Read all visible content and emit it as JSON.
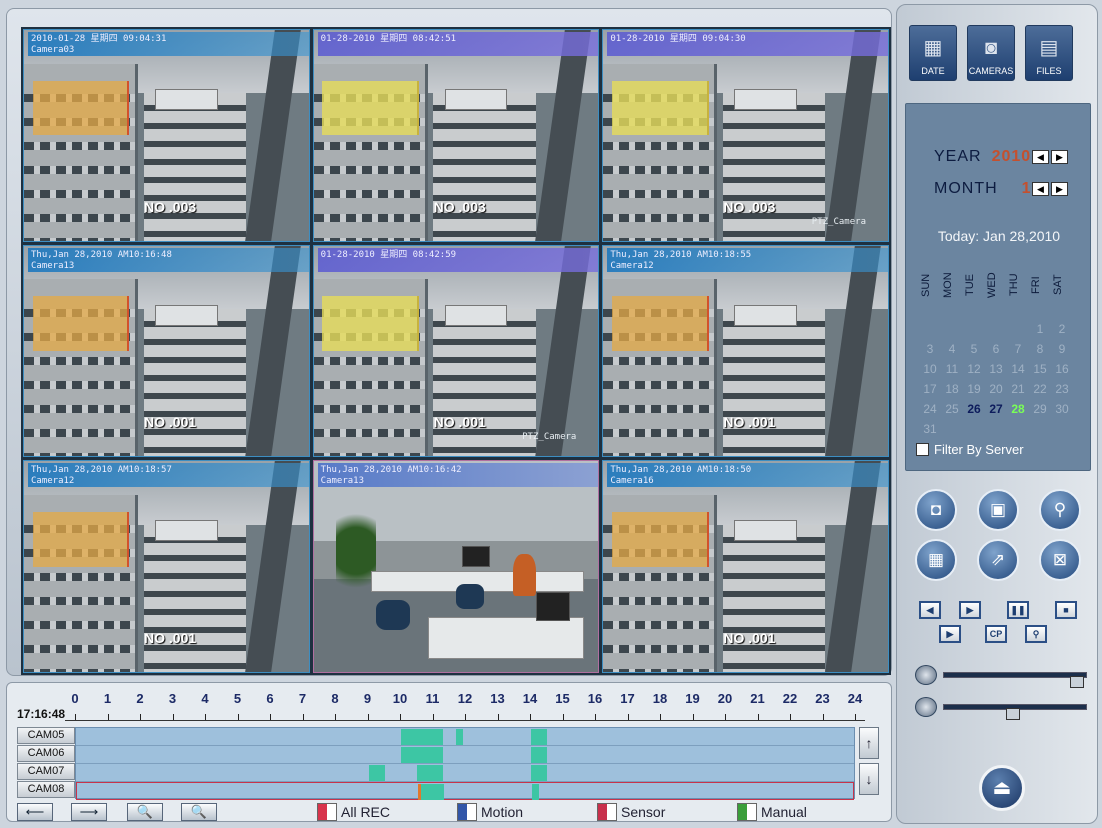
{
  "cameras": [
    {
      "osd": "2010-01-28 星期四 09:04:31\nCamera03",
      "no": "NO .003",
      "ptz": "",
      "style": "or"
    },
    {
      "osd": "01-28-2010 星期四 08:42:51",
      "no": "NO .003",
      "ptz": "",
      "style": "yl"
    },
    {
      "osd": "01-28-2010 星期四 09:04:30",
      "no": "NO .003",
      "ptz": "PTZ_Camera",
      "style": "yl"
    },
    {
      "osd": "Thu,Jan 28,2010 AM10:16:48\nCamera13",
      "no": "NO .001",
      "ptz": "",
      "style": "or"
    },
    {
      "osd": "01-28-2010 星期四 08:42:59",
      "no": "NO .001",
      "ptz": "PTZ_Camera",
      "style": "yl"
    },
    {
      "osd": "Thu,Jan 28,2010 AM10:18:55\nCamera12",
      "no": "NO .001",
      "ptz": "",
      "style": "or"
    },
    {
      "osd": "Thu,Jan 28,2010 AM10:18:57\nCamera12",
      "no": "NO .001",
      "ptz": "",
      "style": "or"
    },
    {
      "osd": "Thu,Jan 28,2010 AM10:16:42\nCamera13",
      "no": "",
      "ptz": "",
      "style": "office"
    },
    {
      "osd": "Thu,Jan 28,2010 AM10:18:50\nCamera16",
      "no": "NO .001",
      "ptz": "",
      "style": "or"
    }
  ],
  "timeline": {
    "clock": "17:16:48",
    "hours": [
      "0",
      "1",
      "2",
      "3",
      "4",
      "5",
      "6",
      "7",
      "8",
      "9",
      "10",
      "11",
      "12",
      "13",
      "14",
      "15",
      "16",
      "17",
      "18",
      "19",
      "20",
      "21",
      "22",
      "23",
      "24"
    ],
    "cams": [
      "CAM05",
      "CAM06",
      "CAM07",
      "CAM08"
    ],
    "recordings": [
      [
        [
          10.0,
          11.3
        ],
        [
          11.7,
          11.9
        ],
        [
          14.0,
          14.5
        ]
      ],
      [
        [
          10.0,
          11.3
        ],
        [
          14.0,
          14.5
        ]
      ],
      [
        [
          9.0,
          9.5
        ],
        [
          10.5,
          11.3
        ],
        [
          14.0,
          14.5
        ]
      ],
      [
        [
          10.5,
          11.3
        ],
        [
          14.0,
          14.2
        ]
      ]
    ],
    "marker": 10.5,
    "legend": [
      "All REC",
      "Motion",
      "Sensor",
      "Manual"
    ],
    "legend_colors": [
      "#d8344c",
      "#3256a8",
      "#c8304c",
      "#3a9e3a"
    ]
  },
  "side": {
    "top_buttons": [
      "DATE",
      "CAMERAS",
      "FILES"
    ],
    "year_label": "YEAR",
    "year": "2010",
    "month_label": "MONTH",
    "month": "1",
    "today": "Today: Jan 28,2010",
    "dow": [
      "SUN",
      "MON",
      "TUE",
      "WED",
      "THU",
      "FRI",
      "SAT"
    ],
    "days_in_month": 31,
    "first_weekday": 5,
    "highlight_days": [
      26,
      27
    ],
    "current_day": 28,
    "filter": "Filter By Server"
  },
  "colors": {
    "track": "#9ec0dc",
    "segment": "#3dc6a4",
    "accent": "#1e3f70"
  }
}
